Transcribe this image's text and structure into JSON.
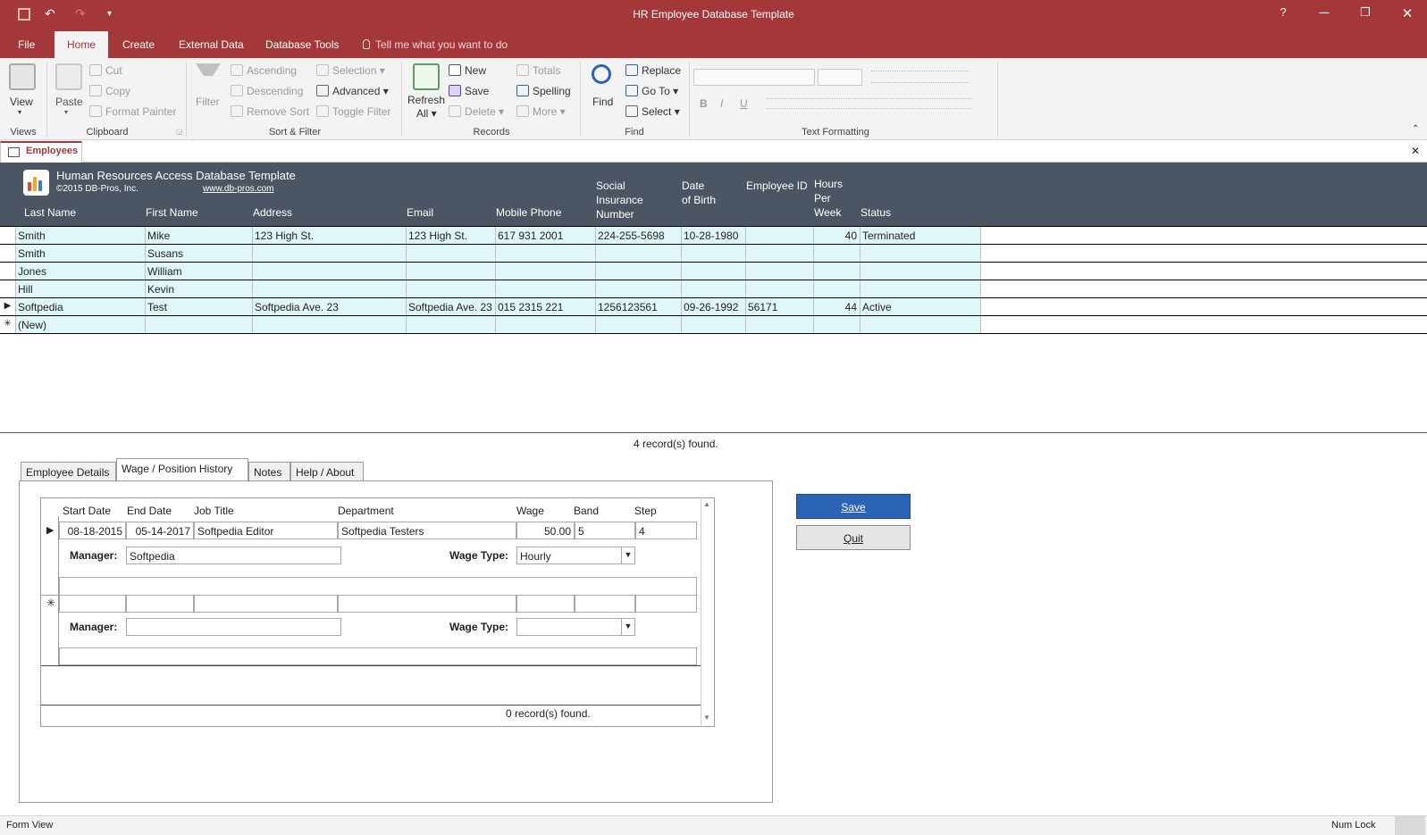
{
  "window": {
    "title": "HR Employee Database Template",
    "help": "?",
    "minimize": "─",
    "restore": "❐",
    "close": "✕"
  },
  "qat": {
    "save_icon": "save-icon",
    "undo": "↶",
    "redo": "↷",
    "customize": "▾"
  },
  "menu": {
    "file": "File",
    "home": "Home",
    "create": "Create",
    "external_data": "External Data",
    "database_tools": "Database Tools",
    "tell_me": "Tell me what you want to do"
  },
  "ribbon": {
    "views": {
      "view": "View",
      "label": "Views"
    },
    "clipboard": {
      "paste": "Paste",
      "cut": "Cut",
      "copy": "Copy",
      "format_painter": "Format Painter",
      "label": "Clipboard"
    },
    "sort_filter": {
      "filter": "Filter",
      "ascending": "Ascending",
      "descending": "Descending",
      "remove_sort": "Remove Sort",
      "selection": "Selection",
      "advanced": "Advanced",
      "toggle_filter": "Toggle Filter",
      "label": "Sort & Filter"
    },
    "records": {
      "refresh_line1": "Refresh",
      "refresh_line2": "All",
      "new": "New",
      "save": "Save",
      "delete": "Delete",
      "totals": "Totals",
      "spelling": "Spelling",
      "more": "More",
      "label": "Records"
    },
    "find": {
      "find": "Find",
      "replace": "Replace",
      "goto": "Go To",
      "select": "Select",
      "label": "Find"
    },
    "text_formatting": {
      "bold": "B",
      "italic": "I",
      "underline": "U",
      "label": "Text Formatting"
    }
  },
  "doc_tab": {
    "title": "Employees",
    "close": "✕"
  },
  "header": {
    "app_title": "Human Resources Access Database Template",
    "copyright": "©2015 DB-Pros, Inc.",
    "url": "www.db-pros.com"
  },
  "columns": {
    "last_name": "Last Name",
    "first_name": "First Name",
    "address": "Address",
    "email": "Email",
    "mobile": "Mobile Phone",
    "sin_1": "Social",
    "sin_2": "Insurance",
    "sin_3": "Number",
    "dob_1": "Date",
    "dob_2": "of Birth",
    "emp_id": "Employee ID",
    "hours_1": "Hours",
    "hours_2": "Per",
    "hours_3": "Week",
    "status": "Status"
  },
  "rows": [
    {
      "last": "Smith",
      "first": "Mike",
      "address": "123 High St.",
      "email": "123 High St.",
      "mobile": "617 931 2001",
      "sin": "224-255-5698",
      "dob": "10-28-1980",
      "emp_id": "",
      "hours": "40",
      "status": "Terminated",
      "selector": ""
    },
    {
      "last": "Smith",
      "first": "Susans",
      "address": "",
      "email": "",
      "mobile": "",
      "sin": "",
      "dob": "",
      "emp_id": "",
      "hours": "",
      "status": "",
      "selector": ""
    },
    {
      "last": "Jones",
      "first": "William",
      "address": "",
      "email": "",
      "mobile": "",
      "sin": "",
      "dob": "",
      "emp_id": "",
      "hours": "",
      "status": "",
      "selector": ""
    },
    {
      "last": "Hill",
      "first": "Kevin",
      "address": "",
      "email": "",
      "mobile": "",
      "sin": "",
      "dob": "",
      "emp_id": "",
      "hours": "",
      "status": "",
      "selector": ""
    },
    {
      "last": "Softpedia",
      "first": "Test",
      "address": "Softpedia Ave. 23",
      "email": "Softpedia Ave. 23",
      "mobile": "015 2315 221",
      "sin": "1256123561",
      "dob": "09-26-1992",
      "emp_id": "56171",
      "hours": "44",
      "status": "Active",
      "selector": "▶"
    },
    {
      "last": "(New)",
      "first": "",
      "address": "",
      "email": "",
      "mobile": "",
      "sin": "",
      "dob": "",
      "emp_id": "",
      "hours": "",
      "status": "",
      "selector": "✳"
    }
  ],
  "records_found": {
    "count": "4",
    "text": "record(s) found."
  },
  "form_tabs": {
    "details": "Employee Details",
    "wage": "Wage / Position History",
    "notes": "Notes",
    "help": "Help / About"
  },
  "wage": {
    "headers": {
      "start": "Start Date",
      "end": "End Date",
      "job": "Job Title",
      "dept": "Department",
      "wage": "Wage",
      "band": "Band",
      "step": "Step"
    },
    "row": {
      "start": "08-18-2015",
      "end": "05-14-2017",
      "job": "Softpedia Editor",
      "dept": "Softpedia Testers",
      "wage": "50.00",
      "band": "5",
      "step": "4",
      "selector": "▶"
    },
    "manager_label": "Manager:",
    "manager_value": "Softpedia",
    "wage_type_label": "Wage Type:",
    "wage_type_value": "Hourly",
    "new_selector": "✳",
    "new_manager_label": "Manager:",
    "new_wage_type_label": "Wage Type:",
    "records_count": "0",
    "records_text": "record(s) found."
  },
  "buttons": {
    "save": "Save",
    "quit": "Quit"
  },
  "statusbar": {
    "view": "Form View",
    "numlock": "Num Lock"
  },
  "colors": {
    "brand": "#a4373a",
    "header_bg": "#4b5563",
    "row_fill": "#dff7f8",
    "save_button": "#2b64b4"
  }
}
